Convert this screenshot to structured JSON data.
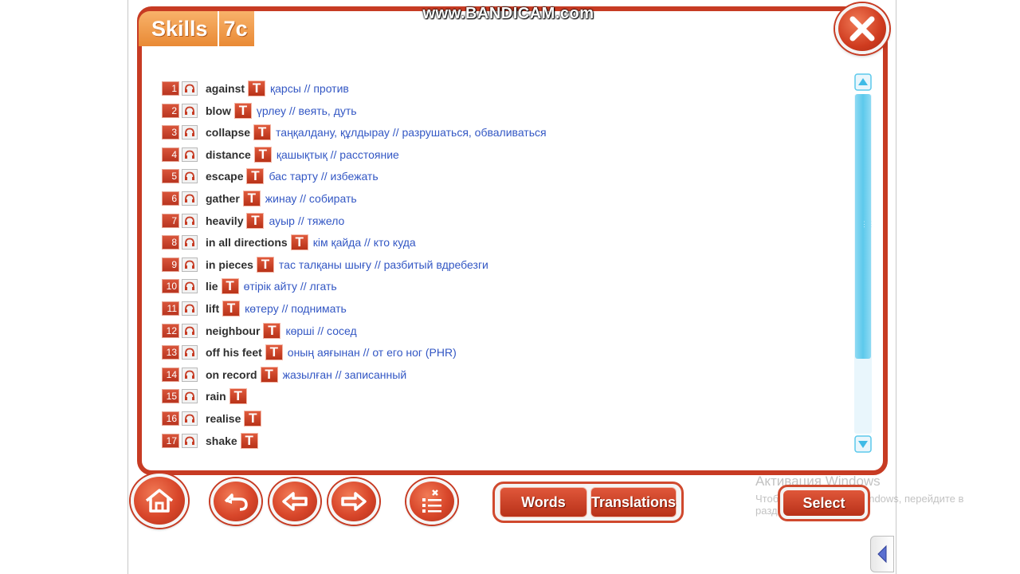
{
  "watermark": "www.BANDICAM.com",
  "header": {
    "section": "Skills",
    "unit": "7c"
  },
  "words": [
    {
      "num": "1",
      "word": "against",
      "translation": "қарсы // против"
    },
    {
      "num": "2",
      "word": "blow",
      "translation": "үрлеу // веять, дуть"
    },
    {
      "num": "3",
      "word": "collapse",
      "translation": "таңқалдану, құлдырау // разрушаться, обваливаться"
    },
    {
      "num": "4",
      "word": "distance",
      "translation": "қашықтық // расстояние"
    },
    {
      "num": "5",
      "word": "escape",
      "translation": "бас тарту // избежать"
    },
    {
      "num": "6",
      "word": "gather",
      "translation": "жинау // собирать"
    },
    {
      "num": "7",
      "word": "heavily",
      "translation": "ауыр // тяжело"
    },
    {
      "num": "8",
      "word": "in all directions",
      "translation": "кім қайда // кто куда"
    },
    {
      "num": "9",
      "word": "in pieces",
      "translation": "тас талқаны шығу // разбитый вдребезги"
    },
    {
      "num": "10",
      "word": "lie",
      "translation": "өтірік айту // лгать"
    },
    {
      "num": "11",
      "word": "lift",
      "translation": "көтеру // поднимать"
    },
    {
      "num": "12",
      "word": "neighbour",
      "translation": "көрші // сосед"
    },
    {
      "num": "13",
      "word": "off his feet",
      "translation": "оның аяғынан // от его ног (PHR)"
    },
    {
      "num": "14",
      "word": "on record",
      "translation": "жазылған // записанный"
    },
    {
      "num": "15",
      "word": "rain",
      "translation": ""
    },
    {
      "num": "16",
      "word": "realise",
      "translation": ""
    },
    {
      "num": "17",
      "word": "shake",
      "translation": ""
    }
  ],
  "t_label": "T",
  "toggle": {
    "words": "Words",
    "translations": "Translations"
  },
  "select_label": "Select",
  "activation": {
    "line1": "Активация Windows",
    "line2": "Чтобы активировать Windows, перейдите в раздел «Параметры»."
  },
  "colors": {
    "frame": "#c73b23",
    "accent": "#d8462a",
    "translation_text": "#3357c4",
    "scroll": "#5cc9ec"
  },
  "icons": [
    "close-icon",
    "headphones-icon",
    "home-icon",
    "undo-icon",
    "arrow-left-icon",
    "arrow-right-icon",
    "checklist-icon",
    "triangle-left-icon"
  ]
}
